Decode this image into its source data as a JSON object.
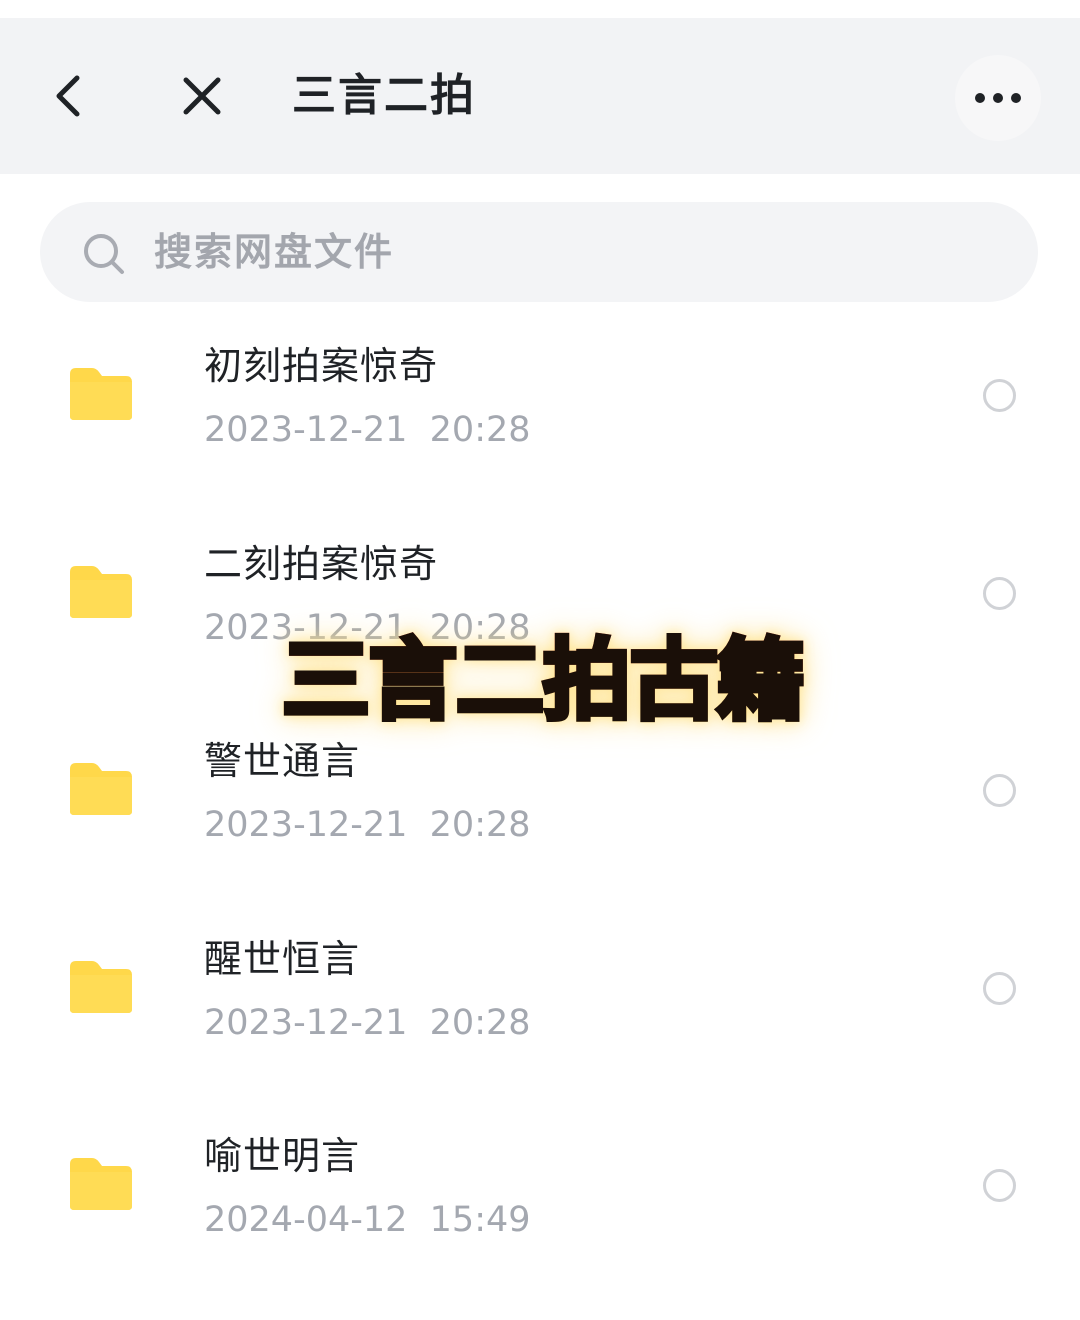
{
  "header": {
    "title": "三言二拍",
    "back_icon": "chevron-left-icon",
    "close_icon": "close-icon",
    "more_icon": "more-horizontal-icon",
    "background": "#f2f3f5"
  },
  "search": {
    "placeholder": "搜索网盘文件",
    "icon": "search-icon"
  },
  "files": [
    {
      "name": "初刻拍案惊奇",
      "date": "2023-12-21  20:28",
      "icon": "folder-icon"
    },
    {
      "name": "二刻拍案惊奇",
      "date": "2023-12-21  20:28",
      "icon": "folder-icon"
    },
    {
      "name": "警世通言",
      "date": "2023-12-21  20:28",
      "icon": "folder-icon"
    },
    {
      "name": "醒世恒言",
      "date": "2023-12-21  20:28",
      "icon": "folder-icon"
    },
    {
      "name": "喻世明言",
      "date": "2024-04-12  15:49",
      "icon": "folder-icon"
    }
  ],
  "overlay": {
    "text": "三言二拍古籍"
  },
  "colors": {
    "folder": "#ffd84a",
    "date_text": "#a4a8b0",
    "name_text": "#1f2226",
    "radio_border": "#d0d2d6"
  }
}
